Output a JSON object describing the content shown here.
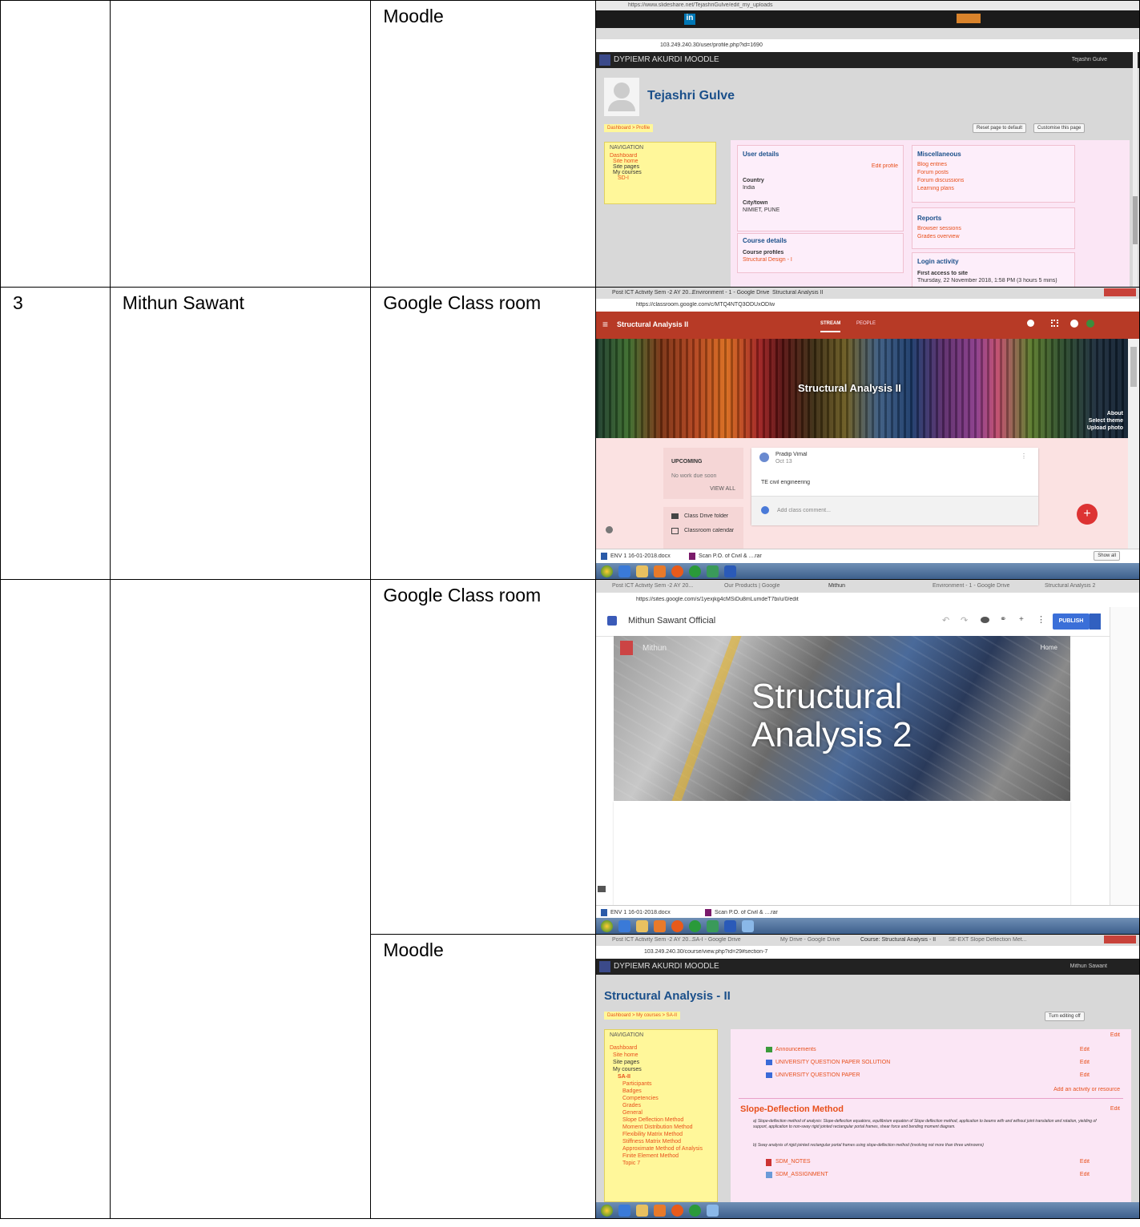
{
  "rows": [
    {
      "num": "",
      "name": "",
      "platform": "Moodle"
    },
    {
      "num": "3",
      "name": "Mithun Sawant",
      "platform": "Google Class room"
    },
    {
      "num": "",
      "name": "",
      "platform": "Google Class room"
    },
    {
      "num": "",
      "name": "",
      "platform": "Moodle"
    }
  ],
  "shot1": {
    "url_top": "https://www.slideshare.net/TejashriGulve/edit_my_uploads",
    "url": "103.249.240.30/user/profile.php?id=1690",
    "site": "DYPIEMR AKURDI MOODLE",
    "user": "Tejashri Gulve",
    "profile_name": "Tejashri Gulve",
    "breadcrumb": "Dashboard > Profile",
    "btn_reset": "Reset page to default",
    "btn_customise": "Customise this page",
    "nav_title": "NAVIGATION",
    "nav_items": [
      "Dashboard",
      "Site home",
      "Site pages",
      "My courses",
      "SD-I"
    ],
    "user_details": "User details",
    "edit_profile": "Edit profile",
    "country_label": "Country",
    "country": "India",
    "city_label": "City/town",
    "city": "NIMIET, PUNE",
    "course_details": "Course details",
    "course_profiles": "Course profiles",
    "course_link": "Structural Design - I",
    "misc": "Miscellaneous",
    "misc_items": [
      "Blog entries",
      "Forum posts",
      "Forum discussions",
      "Learning plans"
    ],
    "reports": "Reports",
    "report_items": [
      "Browser sessions",
      "Grades overview"
    ],
    "login": "Login activity",
    "first_access": "First access to site",
    "first_access_val": "Thursday, 22 November 2018, 1:58 PM (3 hours 5 mins)"
  },
  "shot2": {
    "tabs": [
      "Post ICT Activity Sem -2 AY 20...",
      "Environment - 1 - Google Drive",
      "Structural Analysis II"
    ],
    "url": "https://classroom.google.com/c/MTQ4NTQ3ODUxODIw",
    "class_name": "Structural Analysis II",
    "nav_stream": "STREAM",
    "nav_people": "PEOPLE",
    "banner_title": "Structural Analysis II",
    "about": "About",
    "select_theme": "Select theme",
    "upload_photo": "Upload photo",
    "upcoming": "UPCOMING",
    "no_work": "No work due soon",
    "view_all": "VIEW ALL",
    "poster": "Pradip Vimal",
    "post_date": "Oct 13",
    "post_text": "TE civil engineering",
    "add_comment": "Add class comment...",
    "drive_folder": "Class Drive folder",
    "calendar": "Classroom calendar",
    "dl1": "ENV 1 16-01-2018.docx",
    "dl2": "Scan P.O. of Civil & ....rar",
    "show_all": "Show all"
  },
  "shot3": {
    "tabs": [
      "Post ICT Activity Sem -2 AY 20...",
      "Our Products | Google",
      "Mithun",
      "Environment - 1 - Google Drive",
      "Structural Analysis 2"
    ],
    "url": "https://sites.google.com/s/1yexjkg4cMSiDu8mLumdeT7bi/u/0/edit",
    "site_title": "Mithun Sawant Official",
    "publish": "PUBLISH",
    "header_name": "Mithun",
    "home_menu": "Home",
    "hero_line1": "Structural",
    "hero_line2": "Analysis 2",
    "dl1": "ENV 1 16-01-2018.docx",
    "dl2": "Scan P.O. of Civil & ....rar"
  },
  "shot4": {
    "tabs": [
      "Post ICT Activity Sem -2 AY 20...",
      "SA-I - Google Drive",
      "My Drive - Google Drive",
      "Course: Structural Analysis - II",
      "SE-EXT Slope Deflection Met..."
    ],
    "url": "103.249.240.30/course/view.php?id=29#section-7",
    "site": "DYPIEMR AKURDI MOODLE",
    "user": "Mithun Sawant",
    "course_title": "Structural Analysis - II",
    "breadcrumb": "Dashboard > My courses > SA-II",
    "turn_edit": "Turn editing off",
    "nav_title": "NAVIGATION",
    "nav_items": [
      "Dashboard",
      "Site home",
      "Site pages",
      "My courses",
      "SA-II",
      "Participants",
      "Badges",
      "Competencies",
      "Grades",
      "General",
      "Slope Deflection Method",
      "Moment Distribution Method",
      "Flexibility Matrix Method",
      "Stiffness Matrix Method",
      "Approximate Method of Analysis",
      "Finite Element Method",
      "Topic 7"
    ],
    "activities": [
      "Announcements",
      "UNIVERSITY QUESTION PAPER SOLUTION",
      "UNIVERSITY QUESTION PAPER"
    ],
    "edit": "Edit",
    "add_activity": "Add an activity or resource",
    "section_title": "Slope-Deflection Method",
    "section_desc1": "a) Slope-deflection method of analysis: Slope-deflection equations, equilibrium equation of Slope deflection method, application to beams with and without joint translation and rotation, yielding of support, application to non-sway rigid jointed rectangular portal frames, shear force and bending moment diagram.",
    "section_desc2": "b) Sway analysis of rigid jointed rectangular portal frames using slope-deflection method (involving not more than three unknowns)",
    "files": [
      "SDM_NOTES",
      "SDM_ASSIGNMENT"
    ]
  }
}
